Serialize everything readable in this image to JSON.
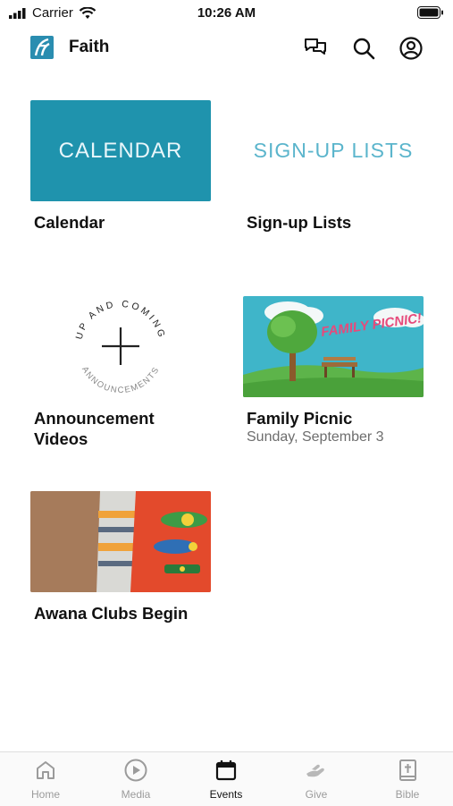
{
  "status_bar": {
    "carrier": "Carrier",
    "time": "10:26 AM"
  },
  "header": {
    "title": "Faith"
  },
  "cards": [
    {
      "thumb_text": "CALENDAR",
      "title": "Calendar"
    },
    {
      "thumb_text": "SIGN-UP LISTS",
      "title": "Sign-up Lists"
    },
    {
      "thumb_top_text": "UP AND COMING",
      "thumb_bottom_text": "ANNOUNCEMENTS",
      "title": "Announcement Videos"
    },
    {
      "thumb_text": "FAMILY PICNIC!",
      "title": "Family Picnic",
      "subtitle": "Sunday, September 3"
    },
    {
      "title": "Awana Clubs Begin"
    }
  ],
  "tabs": [
    {
      "label": "Home",
      "icon": "home-icon"
    },
    {
      "label": "Media",
      "icon": "play-icon"
    },
    {
      "label": "Events",
      "icon": "calendar-icon",
      "active": true
    },
    {
      "label": "Give",
      "icon": "give-icon"
    },
    {
      "label": "Bible",
      "icon": "bible-icon"
    }
  ],
  "colors": {
    "accent": "#1f93ad",
    "tab_inactive": "#9b9b9b",
    "tab_active": "#111111"
  }
}
